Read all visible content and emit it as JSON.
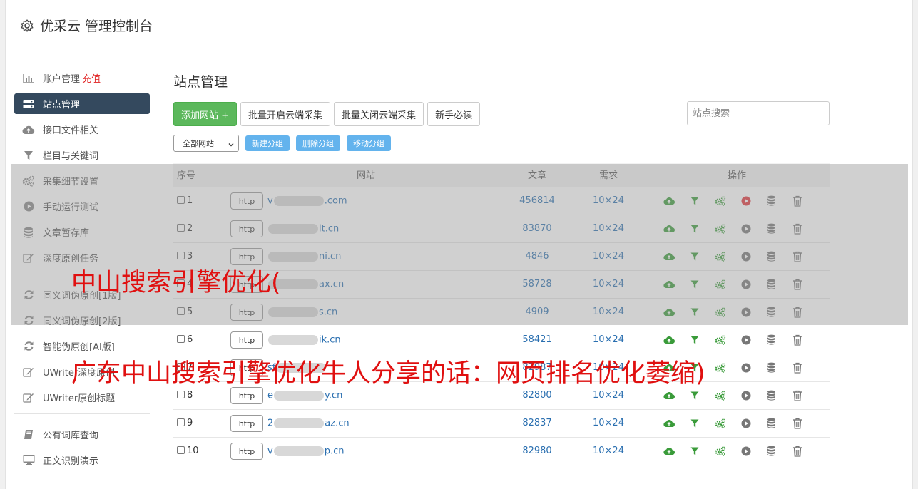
{
  "app": {
    "title": "优采云 管理控制台"
  },
  "sidebar": {
    "items": [
      {
        "label": "账户管理",
        "extra": "充值"
      },
      {
        "label": "站点管理"
      },
      {
        "label": "接口文件相关"
      },
      {
        "label": "栏目与关键词"
      },
      {
        "label": "采集细节设置"
      },
      {
        "label": "手动运行测试"
      },
      {
        "label": "文章暂存库"
      },
      {
        "label": "深度原创任务"
      },
      {
        "label": "同义词伪原创[1版]"
      },
      {
        "label": "同义词伪原创[2版]"
      },
      {
        "label": "智能伪原创[AI版]"
      },
      {
        "label": "UWriter深度原创"
      },
      {
        "label": "UWriter原创标题"
      },
      {
        "label": "公有词库查询"
      },
      {
        "label": "正文识别演示"
      }
    ]
  },
  "main": {
    "title": "站点管理",
    "toolbar": {
      "add_site": "添加网站 +",
      "batch_open": "批量开启云端采集",
      "batch_close": "批量关闭云端采集",
      "newbie": "新手必读"
    },
    "search": {
      "placeholder": "站点搜索"
    },
    "group": {
      "select_value": "全部网站",
      "new_group": "新建分组",
      "delete_group": "删除分组",
      "move_group": "移动分组"
    },
    "table": {
      "headers": [
        "序号",
        "网站",
        "文章",
        "需求",
        "操作"
      ],
      "rows": [
        {
          "idx": "1",
          "http": "http",
          "pre": "v",
          "post": ".com",
          "articles": "456814",
          "demand": "10×24",
          "running": true
        },
        {
          "idx": "2",
          "http": "http",
          "pre": "",
          "post": "lt.cn",
          "articles": "83870",
          "demand": "10×24",
          "running": false
        },
        {
          "idx": "3",
          "http": "http",
          "pre": "",
          "post": "ni.cn",
          "articles": "4846",
          "demand": "10×24",
          "running": false
        },
        {
          "idx": "4",
          "http": "http",
          "pre": "",
          "post": "ax.cn",
          "articles": "58728",
          "demand": "10×24",
          "running": false
        },
        {
          "idx": "5",
          "http": "http",
          "pre": "",
          "post": "s.cn",
          "articles": "4909",
          "demand": "10×24",
          "running": false
        },
        {
          "idx": "6",
          "http": "http",
          "pre": "",
          "post": "ik.cn",
          "articles": "58421",
          "demand": "10×24",
          "running": false
        },
        {
          "idx": "7",
          "http": "http",
          "pre": "sf",
          "post": "",
          "articles": "82987",
          "demand": "10×24",
          "running": false
        },
        {
          "idx": "8",
          "http": "http",
          "pre": "e",
          "post": "y.cn",
          "articles": "82800",
          "demand": "10×24",
          "running": false
        },
        {
          "idx": "9",
          "http": "http",
          "pre": "2",
          "post": "az.cn",
          "articles": "82837",
          "demand": "10×24",
          "running": false
        },
        {
          "idx": "10",
          "http": "http",
          "pre": "v",
          "post": "p.cn",
          "articles": "82980",
          "demand": "10×24",
          "running": false
        }
      ]
    }
  },
  "watermark": {
    "line1": "中山搜索引擎优化(",
    "line2": "广东中山搜索引擎优化牛人分享的话：网页排名优化萎缩)"
  },
  "colors": {
    "accent_green": "#5cb85c",
    "sidebar_active": "#34495e",
    "link_blue": "#2a6fb0",
    "watermark_red": "#e01010",
    "run_red": "#e0333a"
  }
}
